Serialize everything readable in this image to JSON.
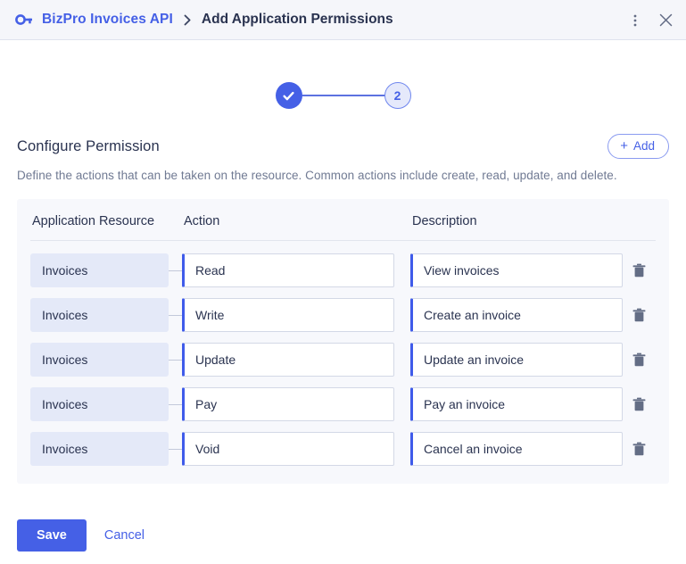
{
  "header": {
    "key_icon": "key-icon",
    "app_name": "BizPro Invoices API",
    "separator": "›",
    "current_page": "Add Application Permissions",
    "menu_icon": "kebab-menu-icon",
    "close_icon": "close-icon"
  },
  "stepper": {
    "step1_state": "completed",
    "step1_glyph": "✓",
    "step2_label": "2",
    "step2_state": "current"
  },
  "section": {
    "title": "Configure Permission",
    "description": "Define the actions that can be taken on the resource. Common actions include create, read, update, and delete.",
    "add_label": "Add",
    "add_plus": "+"
  },
  "table": {
    "columns": [
      "Application Resource",
      "Action",
      "Description"
    ],
    "rows": [
      {
        "resource": "Invoices",
        "action": "Read",
        "description": "View invoices"
      },
      {
        "resource": "Invoices",
        "action": "Write",
        "description": "Create an invoice"
      },
      {
        "resource": "Invoices",
        "action": "Update",
        "description": "Update an invoice"
      },
      {
        "resource": "Invoices",
        "action": "Pay",
        "description": "Pay an invoice"
      },
      {
        "resource": "Invoices",
        "action": "Void",
        "description": "Cancel an invoice"
      }
    ],
    "delete_icon": "trash-icon"
  },
  "footer": {
    "save_label": "Save",
    "cancel_label": "Cancel"
  },
  "colors": {
    "accent": "#4560e6",
    "accent_dark": "#3f5bea",
    "panel_bg": "#f7f8fc",
    "chip_bg": "#e4e9f8",
    "header_bg": "#f5f6fa",
    "text_primary": "#2a3350",
    "text_muted": "#707a93"
  }
}
